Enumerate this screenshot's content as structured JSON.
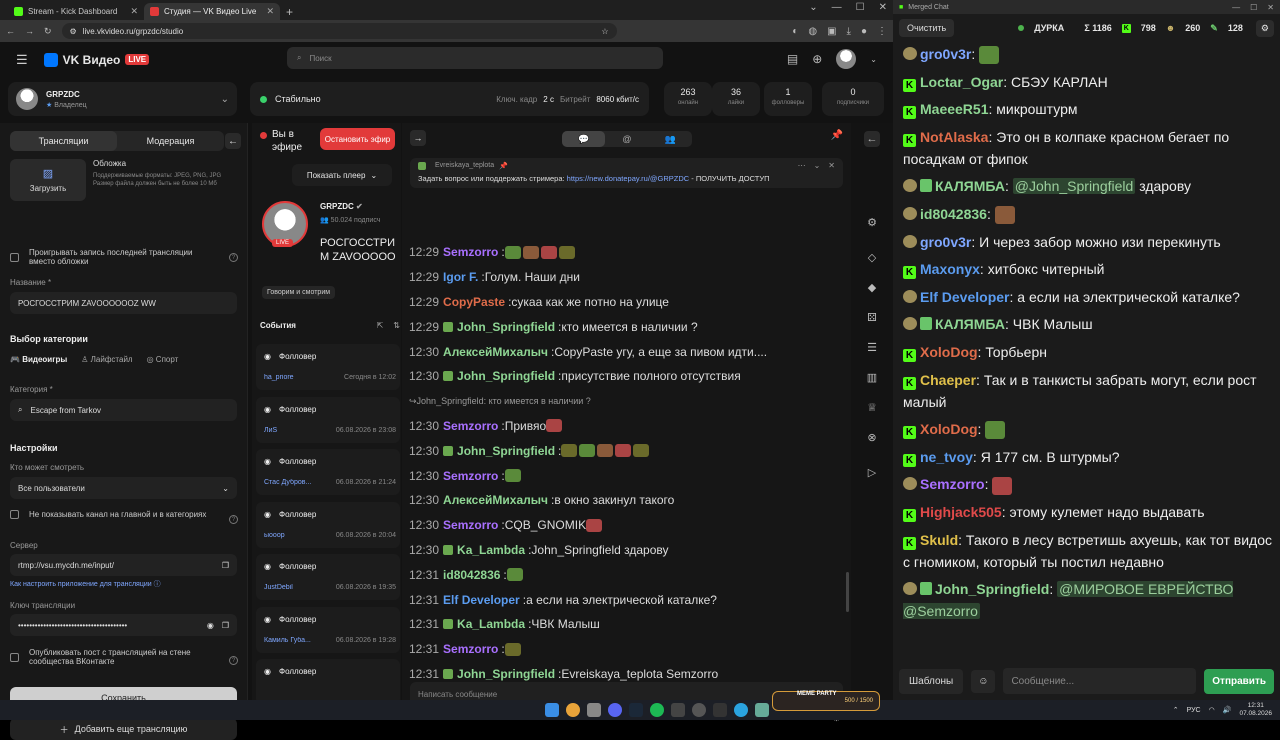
{
  "browser": {
    "tabs": [
      {
        "title": "Stream - Kick Dashboard",
        "active": false
      },
      {
        "title": "Студия — VK Видео Live",
        "active": true
      }
    ],
    "url": "live.vkvideo.ru/grpzdc/studio"
  },
  "header": {
    "logo": "VK Видео",
    "live_badge": "LIVE",
    "search_placeholder": "Поиск"
  },
  "channel": {
    "name": "GRPZDC",
    "role": "Владелец"
  },
  "status": {
    "text": "Стабильно",
    "keyframe_label": "Ключ. кадр",
    "keyframe": "2 с",
    "bitrate_label": "Битрейт",
    "bitrate": "8060 кбит/с"
  },
  "stats": [
    {
      "value": "263",
      "label": "онлайн"
    },
    {
      "value": "36",
      "label": "лайки"
    },
    {
      "value": "1",
      "label": "фолловеры"
    },
    {
      "value": "0",
      "label": "подписчики"
    }
  ],
  "left": {
    "tab_streams": "Трансляции",
    "tab_moderation": "Модерация",
    "cover_button": "Загрузить",
    "cover_title": "Обложка",
    "cover_desc": "Поддерживаемые форматы: JPEG, PNG, JPG Размер файла должен быть не более 10 Мб",
    "replay_label": "Проигрывать запись последней трансляции вместо обложки",
    "name_label": "Название *",
    "name_value": "РОСГОССТРИМ ZAVOOOOOOZ WW",
    "category_section": "Выбор категории",
    "cat_tabs": [
      "Видеоигры",
      "Лайфстайл",
      "Спорт"
    ],
    "category_label": "Категория *",
    "category_value": "Escape from Tarkov",
    "settings_section": "Настройки",
    "who_label": "Кто может смотреть",
    "who_value": "Все пользователи",
    "hide_label": "Не показывать канал на главной и в категориях",
    "server_label": "Сервер",
    "server_value": "rtmp://vsu.mycdn.me/input/",
    "howto": "Как настроить приложение для трансляции",
    "key_label": "Ключ трансляции",
    "key_value": "•••••••••••••••••••••••••••••••••••••••",
    "publish_label": "Опубликовать пост с трансляцией на стене сообщества ВКонтакте",
    "save": "Сохранить",
    "add": "Добавить еще трансляцию"
  },
  "preview": {
    "on_air": "Вы в эфире",
    "stop": "Остановить эфир",
    "show_player": "Показать плеер",
    "name": "GRPZDC",
    "subs": "50.024 подписч",
    "title": "РОСГОССТРИМ ZAVOOOOOOZ",
    "live": "LIVE",
    "tag": "Говорим и смотрим"
  },
  "events": {
    "title": "События",
    "items": [
      {
        "type": "Фолловер",
        "user": "ha_priore",
        "time": "Сегодня в 12:02"
      },
      {
        "type": "Фолловер",
        "user": "ЛиS",
        "time": "06.08.2026 в 23:08"
      },
      {
        "type": "Фолловер",
        "user": "Стас Дубров...",
        "time": "06.08.2026 в 21:24"
      },
      {
        "type": "Фолловер",
        "user": "ыооор",
        "time": "06.08.2026 в 20:04"
      },
      {
        "type": "Фолловер",
        "user": "JustDebil",
        "time": "06.08.2026 в 19:35"
      },
      {
        "type": "Фолловер",
        "user": "Камиль Губа...",
        "time": "06.08.2026 в 19:28"
      },
      {
        "type": "Фолловер",
        "user": "",
        "time": ""
      }
    ]
  },
  "chat": {
    "pinned_author": "Evreiskaya_teplota",
    "pinned_text": "Задать вопрос или поддержать стримера: ",
    "pinned_link": "https://new.donatepay.ru/@GRPZDC",
    "pinned_rest": " - ПОЛУЧИТЬ ДОСТУП",
    "reply_text": "John_Springfield: кто имеется в наличии ?",
    "input_placeholder": "Написать сообщение",
    "messages": [
      {
        "time": "12:29",
        "user": "Semzorro",
        "color": "#a970ff",
        "text": ""
      },
      {
        "time": "12:29",
        "user": "Igor F.",
        "color": "#5b9cf0",
        "text": "Голум. Наши дни"
      },
      {
        "time": "12:29",
        "user": "CopyPaste",
        "color": "#e06c4a",
        "text": "сукаа как же потно на улице"
      },
      {
        "time": "12:29",
        "user": "John_Springfield",
        "color": "#8fd694",
        "text": "кто имеется в наличии ?"
      },
      {
        "time": "12:30",
        "user": "АлексейМихалыч",
        "color": "#8fd694",
        "text": "CopyPaste  угу, а еще за пивом идти...."
      },
      {
        "time": "12:30",
        "user": "John_Springfield",
        "color": "#8fd694",
        "text": "присутствие полного отсутствия"
      },
      {
        "time": "12:30",
        "user": "Semzorro",
        "color": "#a970ff",
        "text": "Привяо"
      },
      {
        "time": "12:30",
        "user": "John_Springfield",
        "color": "#8fd694",
        "text": ""
      },
      {
        "time": "12:30",
        "user": "Semzorro",
        "color": "#a970ff",
        "text": ""
      },
      {
        "time": "12:30",
        "user": "АлексейМихалыч",
        "color": "#8fd694",
        "text": "в окно закинул такого"
      },
      {
        "time": "12:30",
        "user": "Semzorro",
        "color": "#a970ff",
        "text": "CQB_GNOMIK"
      },
      {
        "time": "12:30",
        "user": "Ka_Lambda",
        "color": "#8fd694",
        "text": "John_Springfield  здарову"
      },
      {
        "time": "12:31",
        "user": "id8042836",
        "color": "#8fd694",
        "text": ""
      },
      {
        "time": "12:31",
        "user": "Elf Developer",
        "color": "#5b9cf0",
        "text": "а если на электрической каталке?"
      },
      {
        "time": "12:31",
        "user": "Ka_Lambda",
        "color": "#8fd694",
        "text": "ЧВК Малыш"
      },
      {
        "time": "12:31",
        "user": "Semzorro",
        "color": "#a970ff",
        "text": ""
      },
      {
        "time": "12:31",
        "user": "John_Springfield",
        "color": "#8fd694",
        "text": "Evreiskaya_teplota  Semzorro"
      }
    ]
  },
  "merged": {
    "window_title": "Merged Chat",
    "clear": "Очистить",
    "channel": "ДУРКА",
    "total": "Σ 1186",
    "kick": "798",
    "twitch": "260",
    "other": "128",
    "templates": "Шаблоны",
    "input_placeholder": "Сообщение...",
    "send": "Отправить",
    "messages": [
      {
        "user": "gro0v3r",
        "color": "#7fa7ff",
        "text": ""
      },
      {
        "user": "Loctar_Ogar",
        "color": "#8fd694",
        "text": "СБЭУ КАРЛАН"
      },
      {
        "user": "MaeeeR51",
        "color": "#8fd694",
        "text": "микроштурм"
      },
      {
        "user": "NotAlaska",
        "color": "#e06c4a",
        "text": "Это он в колпаке красном бегает по посадкам от фипок"
      },
      {
        "user": "КАЛЯМБА",
        "color": "#8fd694",
        "mention": "@John_Springfield",
        "text": "здарову"
      },
      {
        "user": "id8042836",
        "color": "#8fd694",
        "text": ""
      },
      {
        "user": "gro0v3r",
        "color": "#7fa7ff",
        "text": "И через забор можно изи перекинуть"
      },
      {
        "user": "Maxonyx",
        "color": "#5b9cf0",
        "text": "хитбокс читерный"
      },
      {
        "user": "Elf Developer",
        "color": "#5b9cf0",
        "text": "а если на электрической каталке?"
      },
      {
        "user": "КАЛЯМБА",
        "color": "#8fd694",
        "text": "ЧВК Малыш"
      },
      {
        "user": "XoloDog",
        "color": "#e06c4a",
        "text": "Торбьерн"
      },
      {
        "user": "Chaeper",
        "color": "#e0c04a",
        "text": "Так и в танкисты забрать могут, если рост малый"
      },
      {
        "user": "XoloDog",
        "color": "#e06c4a",
        "text": ""
      },
      {
        "user": "ne_tvoy",
        "color": "#5b9cf0",
        "text": "Я 177 см. В штурмы?"
      },
      {
        "user": "Semzorro",
        "color": "#a970ff",
        "text": ""
      },
      {
        "user": "Highjack505",
        "color": "#e04a4a",
        "text": "этому кулемет надо выдавать"
      },
      {
        "user": "Skuld",
        "color": "#e0c04a",
        "text": "Такого в лесу встретишь ахуешь, как тот видос с гномиком, который ты постил недавно"
      },
      {
        "user": "John_Springfield",
        "color": "#8fd694",
        "mention": "@МИРОВОЕ ЕВРЕЙСТВО @Semzorro",
        "text": ""
      }
    ]
  },
  "taskbar": {
    "meme": "MEME PARTY",
    "meme_count": "500 / 1500",
    "lang": "РУС",
    "time": "12:31",
    "date": "07.08.2026"
  },
  "colors": {
    "accent": "#0077ff",
    "live": "#e23a3a",
    "kick": "#53fc18",
    "send": "#2e9e52"
  }
}
